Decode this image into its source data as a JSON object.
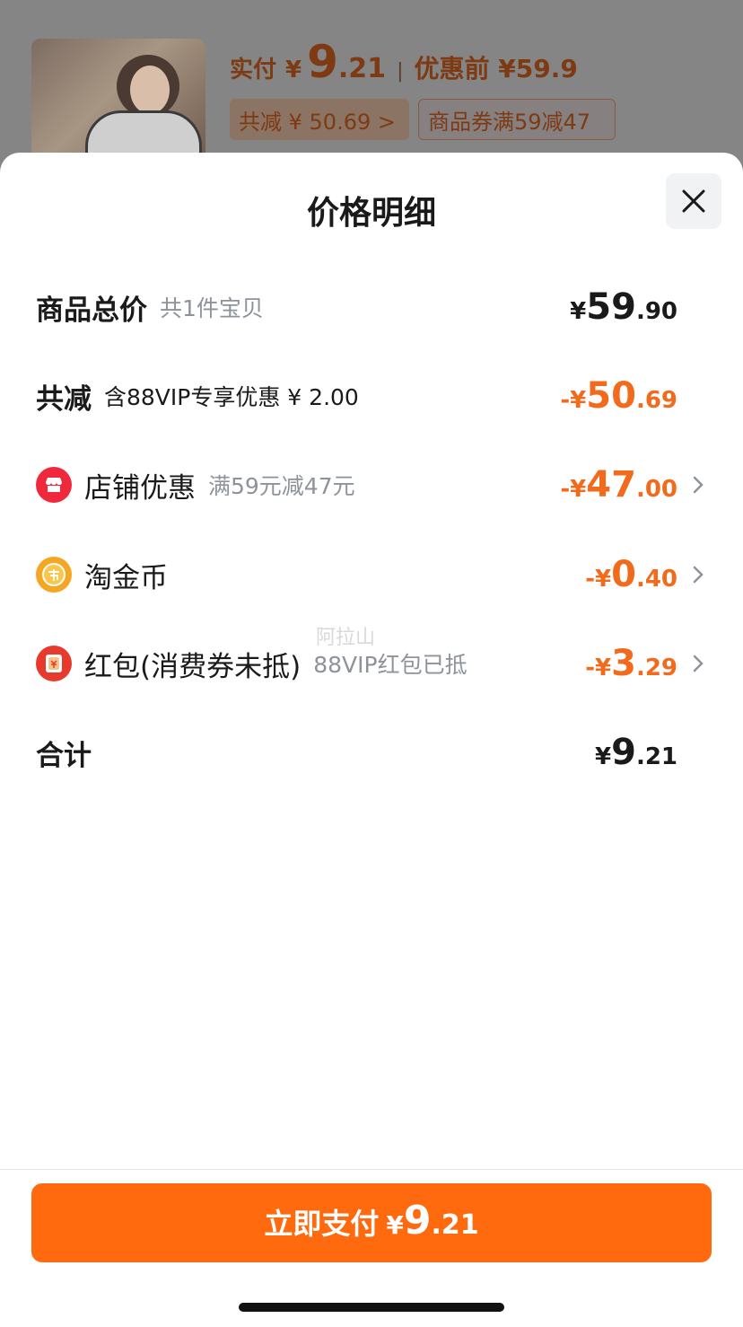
{
  "header": {
    "paid_label": "实付",
    "paid_yen": "¥",
    "paid_int": "9",
    "paid_dec": ".21",
    "separator": "|",
    "before_discount": "优惠前 ¥59.9",
    "tag_total_reduce": "共减 ¥ 50.69 >",
    "tag_coupon": "商品券满59减47"
  },
  "sheet": {
    "title": "价格明细",
    "rows": [
      {
        "label": "商品总价",
        "sub": "共1件宝贝",
        "yen": "¥",
        "int": "59",
        "dec": ".90"
      },
      {
        "label": "共减",
        "sub": "含88VIP专享优惠 ¥ 2.00",
        "yen": "-¥",
        "int": "50",
        "dec": ".69"
      },
      {
        "label": "店铺优惠",
        "sub": "满59元减47元",
        "yen": "-¥",
        "int": "47",
        "dec": ".00",
        "icon": "shop-icon"
      },
      {
        "label": "淘金币",
        "sub": "",
        "yen": "-¥",
        "int": "0",
        "dec": ".40",
        "icon": "coin-icon"
      },
      {
        "label": "红包(消费券未抵)",
        "sub": "88VIP红包已抵",
        "yen": "-¥",
        "int": "3",
        "dec": ".29",
        "icon": "red-packet-icon"
      },
      {
        "label": "合计",
        "sub": "",
        "yen": "¥",
        "int": "9",
        "dec": ".21"
      }
    ],
    "watermark": "阿拉山"
  },
  "footer": {
    "pay_label": "立即支付",
    "pay_yen": "¥",
    "pay_int": "9",
    "pay_dec": ".21"
  },
  "colors": {
    "accent": "#ff6a0f",
    "discount": "#f26a1b",
    "text": "#1a1a1a",
    "muted": "#8e939b"
  }
}
